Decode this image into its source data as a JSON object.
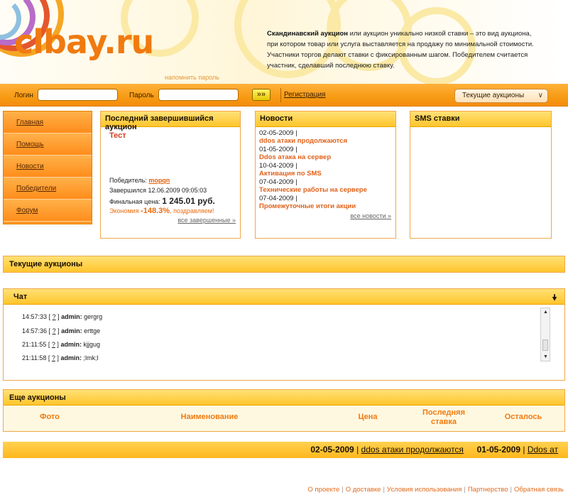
{
  "header": {
    "logo_text": "bay.ru",
    "remind_link": "напомнить пароль",
    "intro_bold": "Скандинавский аукцион",
    "intro_rest": " или аукцион уникально низкой ставки – это вид аукциона, при котором товар или услуга выставляется на продажу по минимальной стоимости. Участники торгов делают ставки с фиксированным шагом. Победителем считается участник, сделавший последнюю ставку."
  },
  "login": {
    "login_label": "Логин",
    "password_label": "Пароль",
    "go_label": "»»",
    "register_link": "Регистрация",
    "select_value": "Текущие аукционы",
    "select_chevron": "∨"
  },
  "nav": {
    "items": [
      {
        "label": "Главная"
      },
      {
        "label": "Помощь"
      },
      {
        "label": "Новости"
      },
      {
        "label": "Победители"
      },
      {
        "label": "Форум"
      }
    ]
  },
  "last_auction": {
    "heading": "Последний завершившийся аукцион",
    "title": "Тест",
    "winner_label": "Победитель:",
    "winner_name": "mopqn",
    "ended_text": "Завершился 12.06.2009 09:05:03",
    "final_label": "Финальная цена:",
    "final_price": "1 245.01 руб.",
    "economy_label": "Экономия",
    "economy_value": "-148.3%",
    "economy_rest": ", поздравляем!",
    "more_link": "все завершенные »"
  },
  "news": {
    "heading": "Новости",
    "items": [
      {
        "date": "02-05-2009 |",
        "title": "ddos атаки продолжаются"
      },
      {
        "date": "01-05-2009 |",
        "title": "Ddos атака на сервер"
      },
      {
        "date": "10-04-2009 |",
        "title": "Активация по SMS"
      },
      {
        "date": "07-04-2009 |",
        "title": "Технические работы на сервере"
      },
      {
        "date": "07-04-2009 |",
        "title": "Промежуточные итоги акции"
      }
    ],
    "more_link": "все новости »"
  },
  "sms": {
    "heading": "SMS ставки"
  },
  "current": {
    "heading": "Текущие аукционы"
  },
  "chat": {
    "heading": "Чат",
    "arrow": "🠟",
    "messages": [
      {
        "time": "14:57:33 [",
        "q": "?",
        "close": "]",
        "user": "admin:",
        "text": "gergrg"
      },
      {
        "time": "14:57:36 [",
        "q": "?",
        "close": "]",
        "user": "admin:",
        "text": "erttge"
      },
      {
        "time": "21:11:55 [",
        "q": "?",
        "close": "]",
        "user": "admin:",
        "text": "kjjgug"
      },
      {
        "time": "21:11:58 [",
        "q": "?",
        "close": "]",
        "user": "admin:",
        "text": ";lmk;l"
      }
    ]
  },
  "more_auctions": {
    "heading": "Еще аукционы",
    "columns": [
      "Фото",
      "Наименование",
      "Цена",
      "Последняя ставка",
      "Осталось"
    ]
  },
  "ticker": {
    "items": [
      {
        "date": "02-05-2009",
        "sep": "|",
        "title": "ddos атаки продолжаются"
      },
      {
        "date": "01-05-2009",
        "sep": "|",
        "title": "Ddos ат"
      }
    ]
  },
  "footer": {
    "links": [
      "О проекте",
      "О доставке",
      "Условия использования",
      "Партнерство",
      "Обратная связь"
    ],
    "separator": "|"
  },
  "colors": {
    "orange": "#f79b14",
    "yellow": "#ffc52d",
    "accent_text": "#e0621b"
  }
}
